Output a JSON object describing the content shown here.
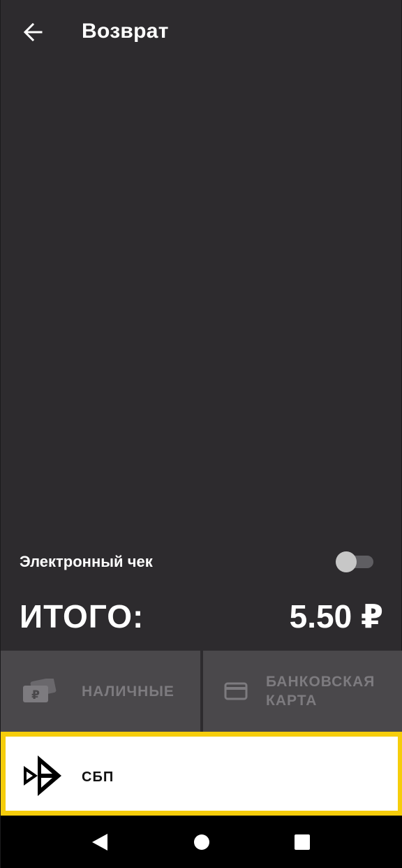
{
  "header": {
    "title": "Возврат",
    "back_icon": "arrow-left-icon"
  },
  "receipt": {
    "label": "Электронный чек",
    "toggle_on": false
  },
  "total": {
    "label": "ИТОГО:",
    "amount": "5.50 ₽"
  },
  "payment": {
    "cash": {
      "label": "НАЛИЧНЫЕ",
      "icon": "cash-ruble-icon",
      "enabled": false
    },
    "card": {
      "label_line1": "БАНКОВСКАЯ",
      "label_line2": "КАРТА",
      "icon": "credit-card-icon",
      "enabled": false
    },
    "sbp": {
      "label": "СБП",
      "icon": "sbp-logo-icon",
      "highlight_color": "#f6cd0b"
    }
  },
  "navbar": {
    "back_icon": "nav-back-triangle-icon",
    "home_icon": "nav-home-circle-icon",
    "recent_icon": "nav-recent-square-icon"
  },
  "colors": {
    "background": "#2d2b2e",
    "button_disabled": "#4a484b",
    "text_disabled": "#7d7b7f",
    "accent": "#f6cd0b"
  }
}
